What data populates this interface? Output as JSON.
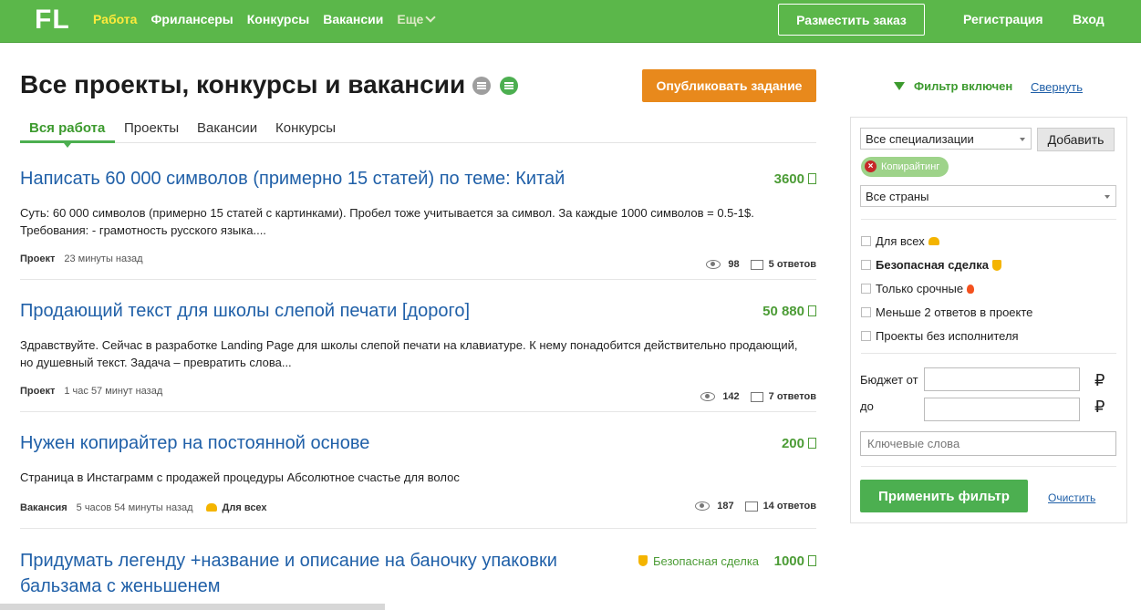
{
  "header": {
    "logo": "FL",
    "nav": [
      {
        "label": "Работа"
      },
      {
        "label": "Фрилансеры"
      },
      {
        "label": "Конкурсы"
      },
      {
        "label": "Вакансии"
      },
      {
        "label": "Еще"
      }
    ],
    "post_button": "Разместить заказ",
    "register": "Регистрация",
    "login": "Вход"
  },
  "main": {
    "title": "Все проекты, конкурсы и вакансии",
    "publish_button": "Опубликовать задание",
    "tabs": [
      "Вся работа",
      "Проекты",
      "Вакансии",
      "Конкурсы"
    ]
  },
  "projects": [
    {
      "title": "Написать 60 000 символов (примерно 15 статей) по теме: Китай",
      "price": "3600",
      "desc": "Суть: 60 000 символов (примерно 15 статей с картинками). Пробел тоже учитывается за символ. За каждые 1000 символов = 0.5-1$. Требования:     - грамотность русского языка....",
      "type": "Проект",
      "time": "23 минуты назад",
      "views": "98",
      "answers": "5 ответов"
    },
    {
      "title": "Продающий текст для школы слепой печати [дорого]",
      "price": "50 880",
      "desc": "Здравствуйте.  Сейчас в разработке Landing Page для школы слепой печати на клавиатуре. К нему понадобится действительно продающий, но душевный текст. Задача – превратить слова...",
      "type": "Проект",
      "time": "1 час 57 минут назад",
      "views": "142",
      "answers": "7 ответов"
    },
    {
      "title": "Нужен копирайтер на постоянной основе",
      "price": "200",
      "desc": "Страница в Инстаграмм с продажей процедуры Абсолютное счастье для волос",
      "type": "Вакансия",
      "time": "5 часов 54 минуты назад",
      "tag": "Для всех",
      "views": "187",
      "answers": "14 ответов"
    },
    {
      "title": "Придумать легенду +название и описание на баночку упаковки бальзама с женьшенем",
      "price": "1000",
      "badge": "Безопасная сделка"
    }
  ],
  "sidebar": {
    "filter_status": "Фильтр включен",
    "collapse": "Свернуть",
    "specialization": "Все специализации",
    "add_button": "Добавить",
    "chip": "Копирайтинг",
    "countries": "Все страны",
    "checkboxes": [
      "Для всех",
      "Безопасная сделка",
      "Только срочные",
      "Меньше 2 ответов в проекте",
      "Проекты без исполнителя"
    ],
    "budget_from": "Бюджет от",
    "budget_to": "до",
    "currency": "₽",
    "keywords_placeholder": "Ключевые слова",
    "apply_button": "Применить фильтр",
    "clear_link": "Очистить"
  }
}
